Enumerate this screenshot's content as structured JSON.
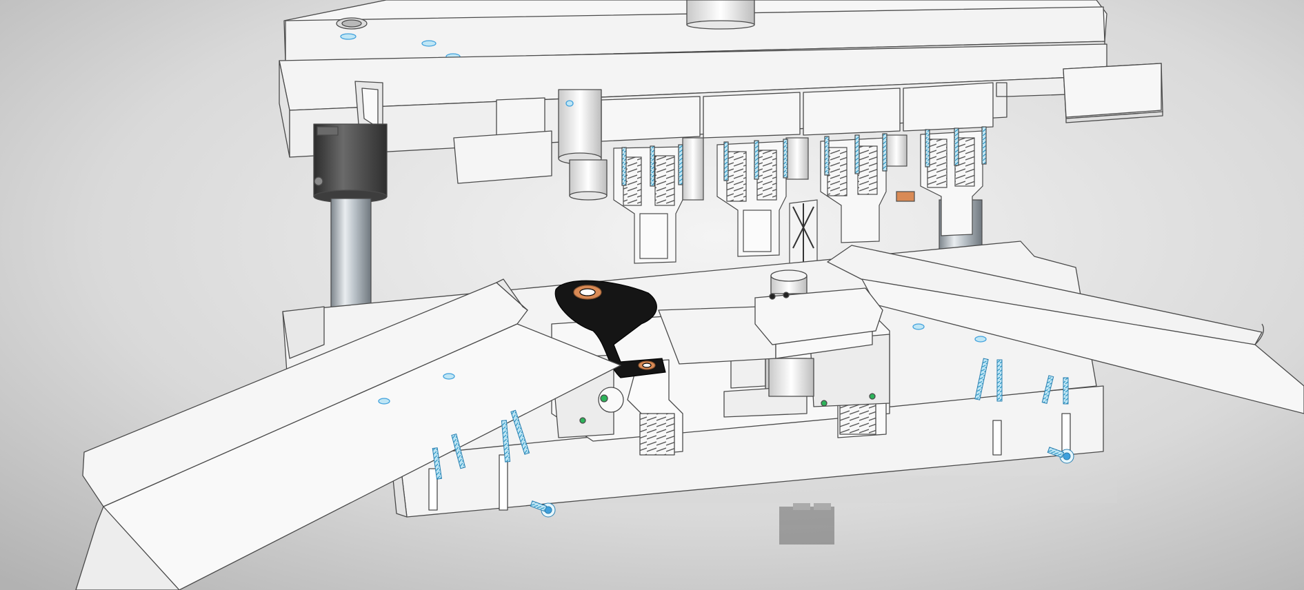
{
  "scene": {
    "background_light": "#f4f4f4",
    "background_dark": "#b2b2b2",
    "part_fill": "#f6f6f6",
    "part_shade": "#e2e2e2",
    "edge_color": "#4a4a4a",
    "stamped_part_color": "#151515",
    "accent_blue": "#3fa0dc",
    "spring_green": "#2db35a",
    "copper": "#d98a55",
    "guide_post_color": "#9aa3ab",
    "bushing_color": "#4d4d4d"
  }
}
